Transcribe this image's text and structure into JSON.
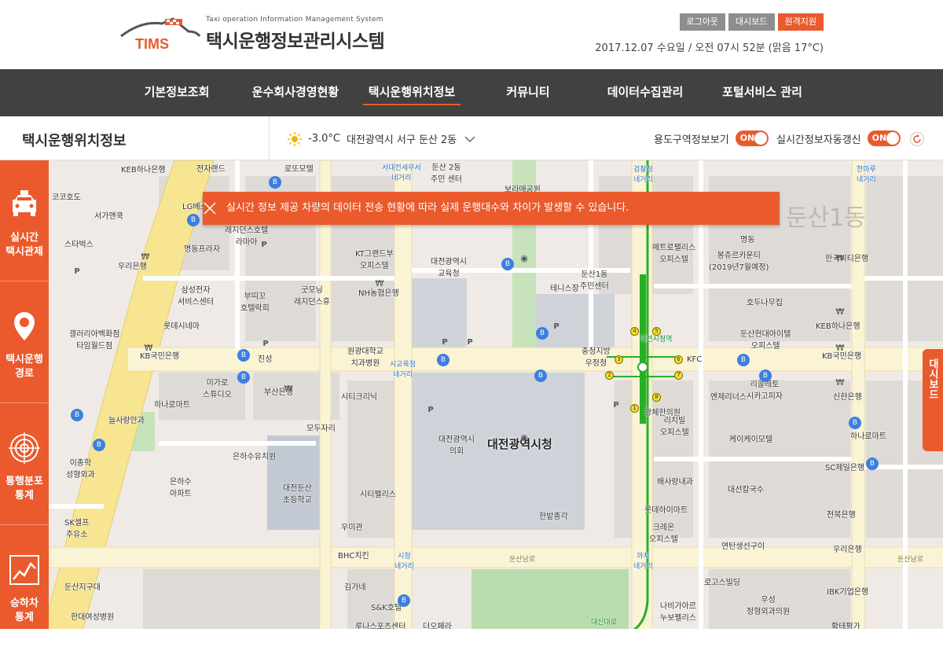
{
  "header": {
    "logo_text": "TIMS",
    "logo_subtitle": "Taxi operation Information Management System",
    "title": "택시운행정보관리시스템",
    "buttons": [
      {
        "label": "로그아웃"
      },
      {
        "label": "대시보드"
      },
      {
        "label": "원격지원"
      }
    ],
    "datetime": "2017.12.07 수요일 / 오전 07시 52분 (맑음 17°C)"
  },
  "nav": {
    "items": [
      {
        "label": "기본정보조회"
      },
      {
        "label": "운수회사경영현황"
      },
      {
        "label": "택시운행위치정보",
        "active": true
      },
      {
        "label": "커뮤니티"
      },
      {
        "label": "데이터수집관리"
      },
      {
        "label": "포털서비스 관리"
      }
    ]
  },
  "subbar": {
    "title": "택시운행위치정보",
    "weather_icon": "sun-icon",
    "temperature": "-3.0°C",
    "location": "대전광역시 서구 둔산 2동",
    "toggles": [
      {
        "label": "용도구역정보보기",
        "state": "ON"
      },
      {
        "label": "실시간정보자동갱신",
        "state": "ON"
      }
    ]
  },
  "sidebar": {
    "items": [
      {
        "label": "실시간\n택시관제",
        "icon": "taxi-icon"
      },
      {
        "label": "택시운행\n경로",
        "icon": "location-pin-icon"
      },
      {
        "label": "통행분포\n통계",
        "icon": "radar-icon"
      },
      {
        "label": "승하차\n통계",
        "icon": "chart-icon"
      }
    ]
  },
  "alert": {
    "message": "실시간 정보 제공 차량의 데이터 전송 현황에 따라 실제 운행대수와 차이가 발생할 수 있습니다."
  },
  "dashboard_tab": {
    "label": "대시보드"
  },
  "map": {
    "area_label": "둔산1동",
    "city_hall": "대전광역시청",
    "labels": [
      "KEB하나은행",
      "전자랜드",
      "로또모텔",
      "서대전세무서\n네거리",
      "둔산 2동\n주민 센터",
      "보라매공원",
      "검찰청\n네거리",
      "한마루\n네거리",
      "코코호도",
      "서가앤쿡",
      "LG베스트샵",
      "레지던스호텔\n라마아",
      "KT그랜드부\n오피스텔",
      "메트로팰리스\n오피스텔",
      "명동",
      "스타벅스",
      "명동프라자",
      "대전광역시\n교육청",
      "둔산1동\n주민센터",
      "봉쥬르카운티\n(2019년7월예정)",
      "한국씨티은행",
      "우리은행",
      "테니스장",
      "삼성전자\n서비스센터",
      "부띠꼬\n호텔락희",
      "굿모닝\n레지던스휴",
      "NH농협은행",
      "호두나무집",
      "롯데시네마",
      "갤러리아백화점\n타임월드점",
      "KEB하나은행",
      "KB국민은행",
      "진성",
      "원광대학교\n치과병원",
      "충청지방\n우정청",
      "둔산현대아이텔\n오피스텔",
      "KB국민은행",
      "KFC",
      "시교육청\n네거리",
      "미가로\n스튜디오",
      "부산은행",
      "하나로마트",
      "시티크리닉",
      "엔제리너스",
      "리콜레토\n시카고피자",
      "신한은행",
      "모두자리",
      "늘사랑안과",
      "광체한의원",
      "은하수유치원",
      "대전시청역",
      "하나로마트",
      "리치빌\n오피스텔",
      "케이케이모텔",
      "대전광역시\n의회",
      "SC제일은행",
      "이종학\n성형외과",
      "은하수\n아파트",
      "대전둔산\n초등학교",
      "시티펠리스",
      "배사랑내과",
      "대선칼국수",
      "SK셀프\n주유소",
      "롯데하이마트",
      "우미관",
      "크레온\n오피스텔",
      "전북은행",
      "한밭종각",
      "BHC치킨",
      "연탄생선구이",
      "우리은행",
      "시청\n네거리",
      "둔산남로",
      "까치\n네거리",
      "둔산남로",
      "둔산지구대",
      "로고스빌딩",
      "IBK기업은행",
      "김가네",
      "S&K호텔",
      "우성\n정형외과의원",
      "한대여성병원",
      "나비가아르\n누보펠리스",
      "루나스포츠센터",
      "더오페라",
      "확테평가",
      "대신대로"
    ]
  }
}
